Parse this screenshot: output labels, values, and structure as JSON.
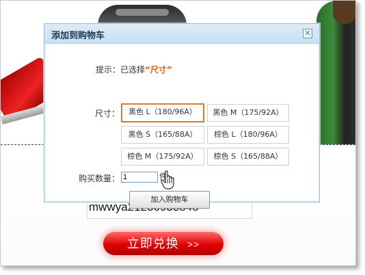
{
  "dialog": {
    "title": "添加到购物车",
    "close_glyph": "✕",
    "hint_label": "提示：已选择",
    "hint_value": "“尺寸”",
    "size_label": "尺寸：",
    "sizes": [
      "黑色 L（180/96A）",
      "黑色 M（175/92A）",
      "黑色 S（165/88A）",
      "棕色 L（180/96A）",
      "棕色 M（175/92A）",
      "棕色 S（165/88A）"
    ],
    "selected_size_index": 0,
    "qty_label": "购买数量：",
    "qty_value": "1",
    "qty_unit": "件",
    "add_button": "加入购物车"
  },
  "page": {
    "code_text": "mwwya21236933845",
    "exchange_button": "立即兑换",
    "exchange_arrows": ">>"
  },
  "colors": {
    "dialog_border": "#8cb9dc",
    "selected_border": "#e07a2b",
    "hint_accent": "#e0640a",
    "exchange_red": "#e00000"
  },
  "icons": {
    "close": "close-icon",
    "cursor": "hand-cursor-icon"
  }
}
